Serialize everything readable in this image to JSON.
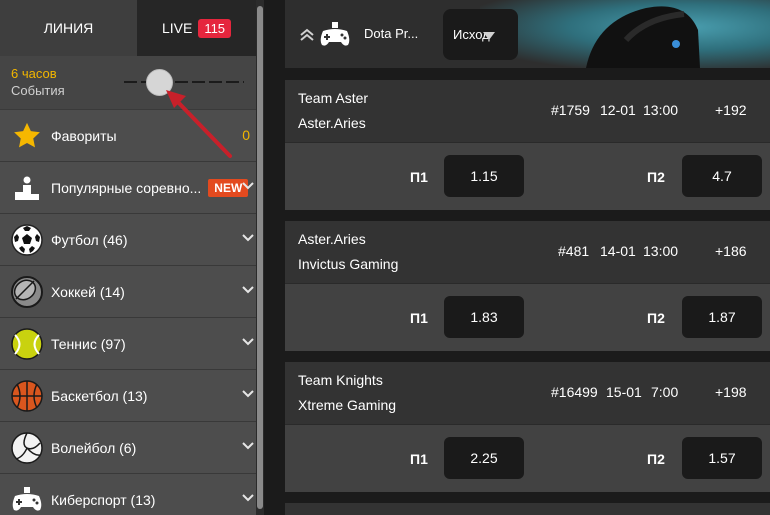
{
  "tabs": {
    "line_label": "ЛИНИЯ",
    "live_label": "LIVE",
    "live_count": "115"
  },
  "filter": {
    "hours_label": "6 часов",
    "events_label": "События"
  },
  "sidebar": {
    "items": [
      {
        "label": "Фавориты",
        "icon": "star-icon",
        "count": "0"
      },
      {
        "label": "Популярные соревно...",
        "icon": "podium-icon",
        "badge": "NEW"
      },
      {
        "label": "Футбол (46)",
        "icon": "soccer-ball-icon"
      },
      {
        "label": "Хоккей (14)",
        "icon": "hockey-puck-icon"
      },
      {
        "label": "Теннис (97)",
        "icon": "tennis-ball-icon"
      },
      {
        "label": "Баскетбол (13)",
        "icon": "basketball-icon"
      },
      {
        "label": "Волейбол (6)",
        "icon": "volleyball-icon"
      },
      {
        "label": "Киберспорт (13)",
        "icon": "gamepad-icon"
      }
    ]
  },
  "header": {
    "game_title": "Dota Pr...",
    "dropdown_label": "Исход"
  },
  "matches": [
    {
      "team1": "Team Aster",
      "team2": "Aster.Aries",
      "number": "#1759",
      "date": "12-01",
      "time": "13:00",
      "more": "+192",
      "p1_label": "П1",
      "p1": "1.15",
      "p2_label": "П2",
      "p2": "4.7"
    },
    {
      "team1": "Aster.Aries",
      "team2": "Invictus Gaming",
      "number": "#481",
      "date": "14-01",
      "time": "13:00",
      "more": "+186",
      "p1_label": "П1",
      "p1": "1.83",
      "p2_label": "П2",
      "p2": "1.87"
    },
    {
      "team1": "Team Knights",
      "team2": "Xtreme Gaming",
      "number": "#16499",
      "date": "15-01",
      "time": "7:00",
      "more": "+198",
      "p1_label": "П1",
      "p1": "2.25",
      "p2_label": "П2",
      "p2": "1.57"
    }
  ],
  "colors": {
    "accent_yellow": "#f2b600",
    "live_red": "#e5263d",
    "new_badge": "#e34a1f",
    "arrow_red": "#c8202a"
  }
}
